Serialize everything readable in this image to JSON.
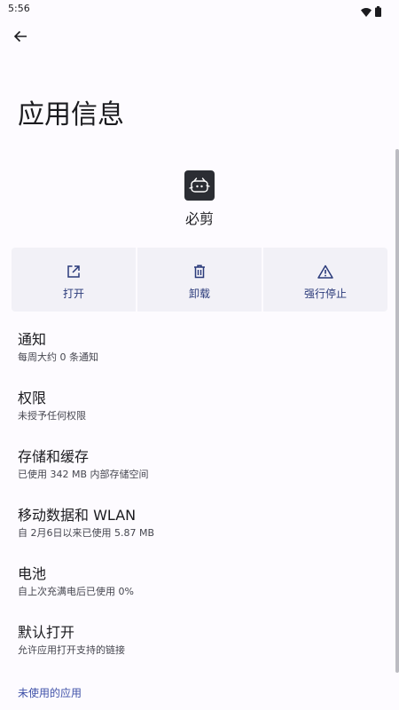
{
  "status_bar": {
    "time": "5:56",
    "icons": [
      "wifi-icon",
      "battery-icon"
    ]
  },
  "header": {
    "back_icon": "arrow-left-icon",
    "title": "应用信息"
  },
  "app": {
    "name": "必剪",
    "icon": "bijian-app-icon"
  },
  "actions": [
    {
      "label": "打开",
      "icon": "open-external-icon"
    },
    {
      "label": "卸载",
      "icon": "trash-icon"
    },
    {
      "label": "强行停止",
      "icon": "warning-icon"
    }
  ],
  "settings": [
    {
      "title": "通知",
      "summary": "每周大约 0 条通知"
    },
    {
      "title": "权限",
      "summary": "未授予任何权限"
    },
    {
      "title": "存储和缓存",
      "summary": "已使用 342 MB 内部存储空间"
    },
    {
      "title": "移动数据和 WLAN",
      "summary": "自 2月6日以来已使用 5.87 MB"
    },
    {
      "title": "电池",
      "summary": "自上次充满电后已使用 0%"
    },
    {
      "title": "默认打开",
      "summary": "允许应用打开支持的链接"
    }
  ],
  "unused_apps_link": "未使用的应用",
  "colors": {
    "background": "#fdfbff",
    "action_tile": "#f2f1f7",
    "action_accent": "#2a3a7a",
    "link": "#3f51a8"
  }
}
